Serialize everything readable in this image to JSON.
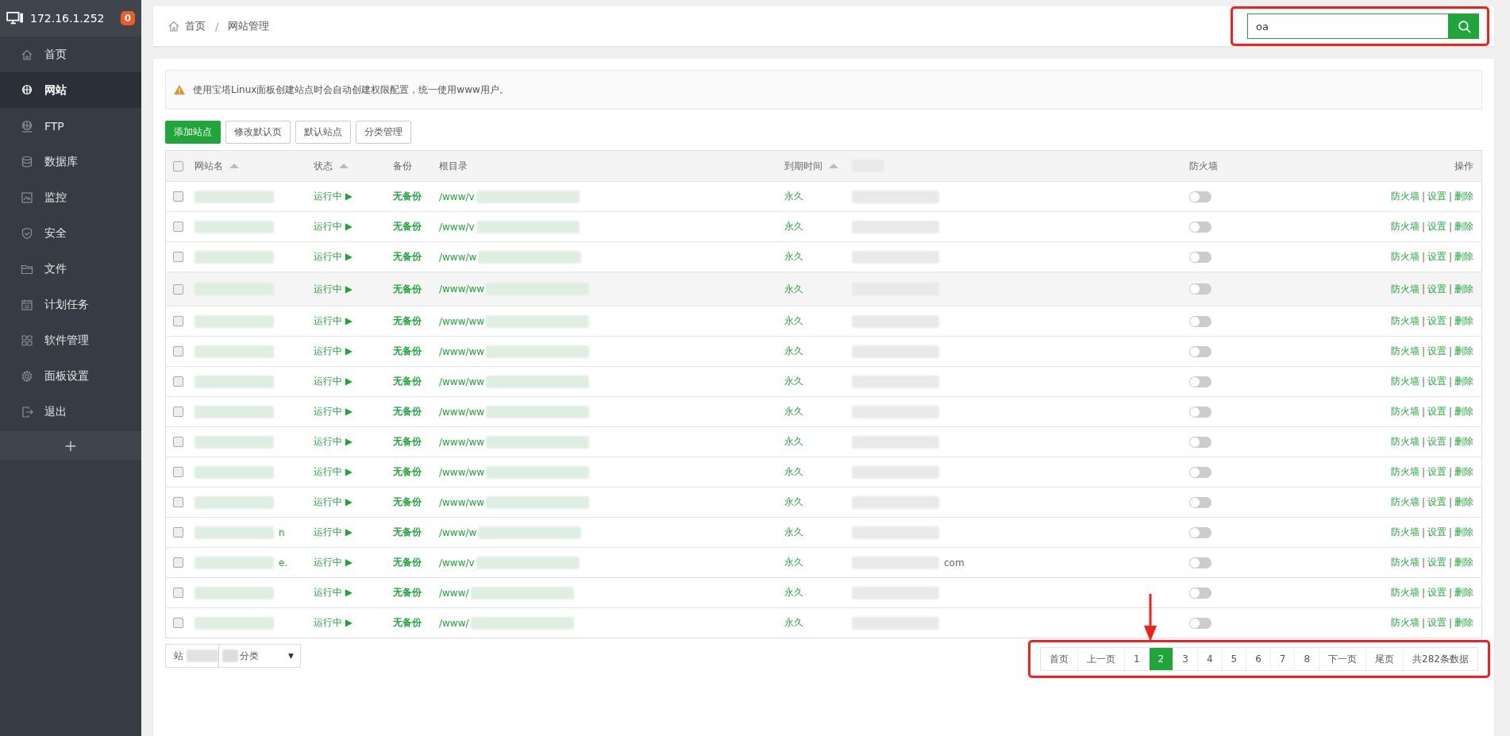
{
  "sidebar": {
    "host": "172.16.1.252",
    "badge": "0",
    "items": [
      {
        "label": "首页",
        "selected": false
      },
      {
        "label": "网站",
        "selected": true
      },
      {
        "label": "FTP",
        "selected": false
      },
      {
        "label": "数据库",
        "selected": false
      },
      {
        "label": "监控",
        "selected": false
      },
      {
        "label": "安全",
        "selected": false
      },
      {
        "label": "文件",
        "selected": false
      },
      {
        "label": "计划任务",
        "selected": false
      },
      {
        "label": "软件管理",
        "selected": false
      },
      {
        "label": "面板设置",
        "selected": false
      },
      {
        "label": "退出",
        "selected": false
      }
    ],
    "add_label": "+"
  },
  "breadcrumb": {
    "home": "首页",
    "separator": "/",
    "current": "网站管理"
  },
  "search": {
    "value": "oa"
  },
  "alert": "使用宝塔Linux面板创建站点时会自动创建权限配置，统一使用www用户。",
  "toolbar_buttons": [
    {
      "label": "添加站点",
      "primary": true
    },
    {
      "label": "修改默认页",
      "primary": false
    },
    {
      "label": "默认站点",
      "primary": false
    },
    {
      "label": "分类管理",
      "primary": false
    }
  ],
  "table": {
    "all_checked": false,
    "columns": [
      {
        "label": "网站名",
        "sortable": true
      },
      {
        "label": "状态",
        "sortable": true
      },
      {
        "label": "备份",
        "sortable": false
      },
      {
        "label": "根目录",
        "sortable": false
      },
      {
        "label": "到期时间",
        "sortable": true
      },
      {
        "sortable": false
      },
      {
        "label": "防火墙",
        "sortable": false
      },
      {
        "label": "操作",
        "sortable": false
      }
    ],
    "rows": [
      {
        "checked": false,
        "status": "运行中 ▶",
        "backup": "无备份",
        "root": "/www/v",
        "expiry": "永久",
        "firewall_on": false,
        "actions": [
          "防火墙",
          "|",
          "设置",
          "|",
          "删除"
        ]
      },
      {
        "checked": false,
        "status": "运行中 ▶",
        "backup": "无备份",
        "root": "/www/v",
        "expiry": "永久",
        "firewall_on": false,
        "actions": [
          "防火墙",
          "|",
          "设置",
          "|",
          "删除"
        ]
      },
      {
        "checked": false,
        "status": "运行中 ▶",
        "backup": "无备份",
        "root": "/www/w",
        "expiry": "永久",
        "firewall_on": false,
        "actions": [
          "防火墙",
          "|",
          "设置",
          "|",
          "删除"
        ]
      },
      {
        "checked": false,
        "status": "运行中 ▶",
        "backup": "无备份",
        "root": "/www/ww",
        "expiry": "永久",
        "firewall_on": false,
        "actions": [
          "防火墙",
          "|",
          "设置",
          "|",
          "删除"
        ]
      },
      {
        "checked": false,
        "status": "运行中 ▶",
        "backup": "无备份",
        "root": "/www/ww",
        "expiry": "永久",
        "firewall_on": false,
        "actions": [
          "防火墙",
          "|",
          "设置",
          "|",
          "删除"
        ]
      },
      {
        "checked": false,
        "status": "运行中 ▶",
        "backup": "无备份",
        "root": "/www/ww",
        "expiry": "永久",
        "firewall_on": false,
        "actions": [
          "防火墙",
          "|",
          "设置",
          "|",
          "删除"
        ]
      },
      {
        "checked": false,
        "status": "运行中 ▶",
        "backup": "无备份",
        "root": "/www/ww",
        "expiry": "永久",
        "firewall_on": false,
        "actions": [
          "防火墙",
          "|",
          "设置",
          "|",
          "删除"
        ]
      },
      {
        "checked": false,
        "status": "运行中 ▶",
        "backup": "无备份",
        "root": "/www/ww",
        "expiry": "永久",
        "firewall_on": false,
        "actions": [
          "防火墙",
          "|",
          "设置",
          "|",
          "删除"
        ]
      },
      {
        "checked": false,
        "status": "运行中 ▶",
        "backup": "无备份",
        "root": "/www/ww",
        "expiry": "永久",
        "firewall_on": false,
        "actions": [
          "防火墙",
          "|",
          "设置",
          "|",
          "删除"
        ]
      },
      {
        "checked": false,
        "status": "运行中 ▶",
        "backup": "无备份",
        "root": "/www/ww",
        "expiry": "永久",
        "firewall_on": false,
        "actions": [
          "防火墙",
          "|",
          "设置",
          "|",
          "删除"
        ]
      },
      {
        "checked": false,
        "status": "运行中 ▶",
        "backup": "无备份",
        "root": "/www/ww",
        "expiry": "永久",
        "firewall_on": false,
        "actions": [
          "防火墙",
          "|",
          "设置",
          "|",
          "删除"
        ]
      },
      {
        "checked": false,
        "name": "n",
        "status": "运行中 ▶",
        "backup": "无备份",
        "root": "/www/w",
        "expiry": "永久",
        "firewall_on": false,
        "actions": [
          "防火墙",
          "|",
          "设置",
          "|",
          "删除"
        ]
      },
      {
        "checked": false,
        "name": "e.",
        "status": "运行中 ▶",
        "backup": "无备份",
        "root": "/www/v",
        "expiry": "永久",
        "remark": "com",
        "firewall_on": false,
        "actions": [
          "防火墙",
          "|",
          "设置",
          "|",
          "删除"
        ]
      },
      {
        "checked": false,
        "status": "运行中 ▶",
        "backup": "无备份",
        "root": "/www/",
        "expiry": "永久",
        "firewall_on": false,
        "actions": [
          "防火墙",
          "|",
          "设置",
          "|",
          "删除"
        ]
      },
      {
        "checked": false,
        "status": "运行中 ▶",
        "backup": "无备份",
        "root": "/www/",
        "expiry": "永久",
        "firewall_on": false,
        "actions": [
          "防火墙",
          "|",
          "设置",
          "|",
          "删除"
        ]
      }
    ]
  },
  "category": {
    "label": "站",
    "value": "分类",
    "caret": "▼"
  },
  "pagination": {
    "pages": [
      {
        "label": "首页",
        "selected": false
      },
      {
        "label": "上一页",
        "selected": false
      },
      {
        "label": "1",
        "selected": false
      },
      {
        "label": "2",
        "selected": true
      },
      {
        "label": "3",
        "selected": false
      },
      {
        "label": "4",
        "selected": false
      },
      {
        "label": "5",
        "selected": false
      },
      {
        "label": "6",
        "selected": false
      },
      {
        "label": "7",
        "selected": false
      },
      {
        "label": "8",
        "selected": false
      },
      {
        "label": "下一页",
        "selected": false
      },
      {
        "label": "尾页",
        "selected": false
      }
    ],
    "total": "共282条数据"
  }
}
